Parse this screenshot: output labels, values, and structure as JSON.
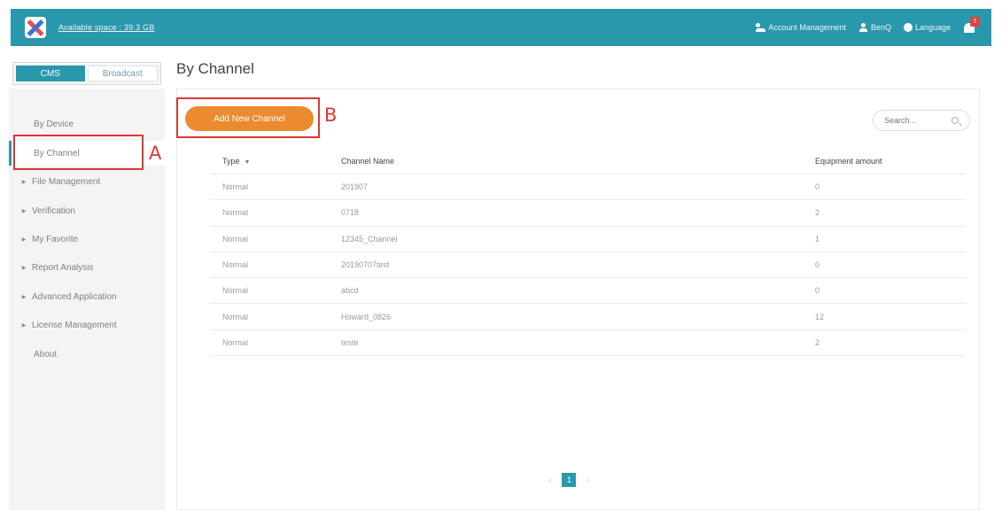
{
  "header": {
    "space_text": "Available space : 39.3 GB",
    "account_management": "Account Management",
    "user": "BenQ",
    "language": "Language",
    "notification_count": "7"
  },
  "tabs": [
    {
      "label": "CMS",
      "active": true
    },
    {
      "label": "Broadcast",
      "active": false
    }
  ],
  "sidebar": {
    "items": [
      {
        "label": "By Device",
        "bullet": false
      },
      {
        "label": "By Channel",
        "bullet": false,
        "selected": true
      },
      {
        "label": "File Management",
        "bullet": true
      },
      {
        "label": "Verification",
        "bullet": true
      },
      {
        "label": "My Favorite",
        "bullet": true
      },
      {
        "label": "Report Analysis",
        "bullet": true
      },
      {
        "label": "Advanced Application",
        "bullet": true
      },
      {
        "label": "License Management",
        "bullet": true
      },
      {
        "label": "About",
        "bullet": false
      }
    ]
  },
  "main": {
    "title": "By Channel",
    "add_button": "Add New Channel",
    "search_placeholder": "Search..."
  },
  "table": {
    "headers": [
      "Type",
      "Channel Name",
      "Equipment amount"
    ],
    "rows": [
      [
        "Normal",
        "201907",
        "0"
      ],
      [
        "Normal",
        "0718",
        "2"
      ],
      [
        "Normal",
        "12345_Channel",
        "1"
      ],
      [
        "Normal",
        "20190707test",
        "0"
      ],
      [
        "Normal",
        "abcd",
        "0"
      ],
      [
        "Normal",
        "Howard_0826",
        "12"
      ],
      [
        "Normal",
        "teste",
        "2"
      ]
    ]
  },
  "pagination": {
    "prev": "‹",
    "current": "1",
    "next": "›"
  },
  "annotations": {
    "a": "A",
    "b": "B"
  },
  "colors": {
    "accent": "#2a98ac",
    "button": "#ec8a2f",
    "annotation": "#d8392f"
  }
}
